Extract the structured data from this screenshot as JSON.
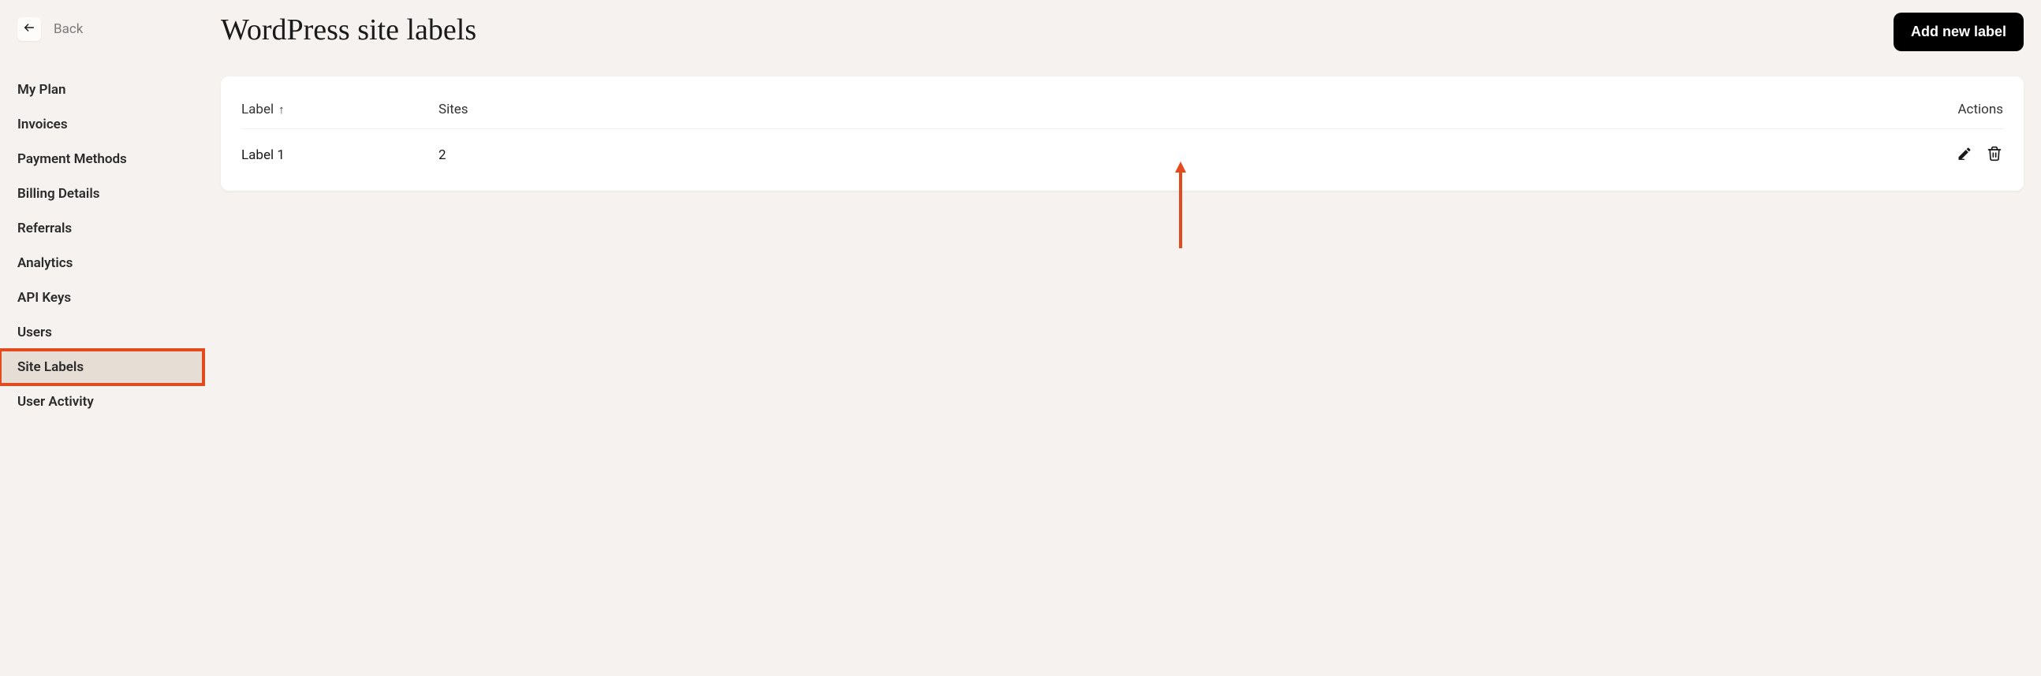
{
  "back": {
    "label": "Back"
  },
  "sidebar": {
    "items": [
      {
        "label": "My Plan",
        "active": false
      },
      {
        "label": "Invoices",
        "active": false
      },
      {
        "label": "Payment Methods",
        "active": false
      },
      {
        "label": "Billing Details",
        "active": false
      },
      {
        "label": "Referrals",
        "active": false
      },
      {
        "label": "Analytics",
        "active": false
      },
      {
        "label": "API Keys",
        "active": false
      },
      {
        "label": "Users",
        "active": false
      },
      {
        "label": "Site Labels",
        "active": true
      },
      {
        "label": "User Activity",
        "active": false
      }
    ]
  },
  "header": {
    "title": "WordPress site labels",
    "add_button": "Add new label"
  },
  "table": {
    "columns": {
      "label": "Label",
      "sort_indicator": "↑",
      "sites": "Sites",
      "actions": "Actions"
    },
    "rows": [
      {
        "label": "Label 1",
        "sites": "2"
      }
    ]
  },
  "annotation": {
    "highlight_nav_item": "Site Labels",
    "arrow_points_to": "delete-icon",
    "highlight_color": "#e34b1f"
  }
}
